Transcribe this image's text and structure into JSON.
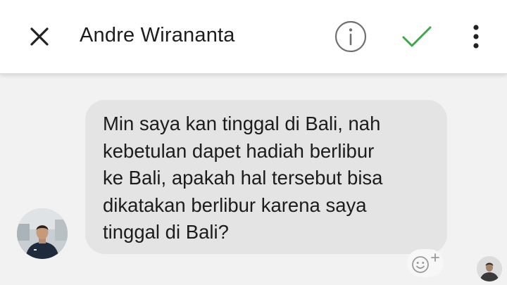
{
  "header": {
    "contact_name": "Andre Wirananta",
    "icons": {
      "close": "close-icon",
      "info": "info-icon",
      "confirm": "checkmark-icon",
      "more": "more-vertical-icon"
    }
  },
  "conversation": {
    "messages": [
      {
        "sender": "Andre Wirananta",
        "text": "Min saya kan tinggal di Bali, nah\nkebetulan dapet hadiah berlibur\nke Bali, apakah hal tersebut bisa\ndikatakan berlibur karena saya\ntinggal di Bali?"
      }
    ],
    "reaction_icon": "add-reaction-icon"
  },
  "colors": {
    "header_background": "#ffffff",
    "page_background": "#f2f2f2",
    "bubble_background": "#e4e4e4",
    "check_color": "#3ca84a",
    "icon_gray": "#6b6b6b",
    "text": "#1c1c1c"
  }
}
